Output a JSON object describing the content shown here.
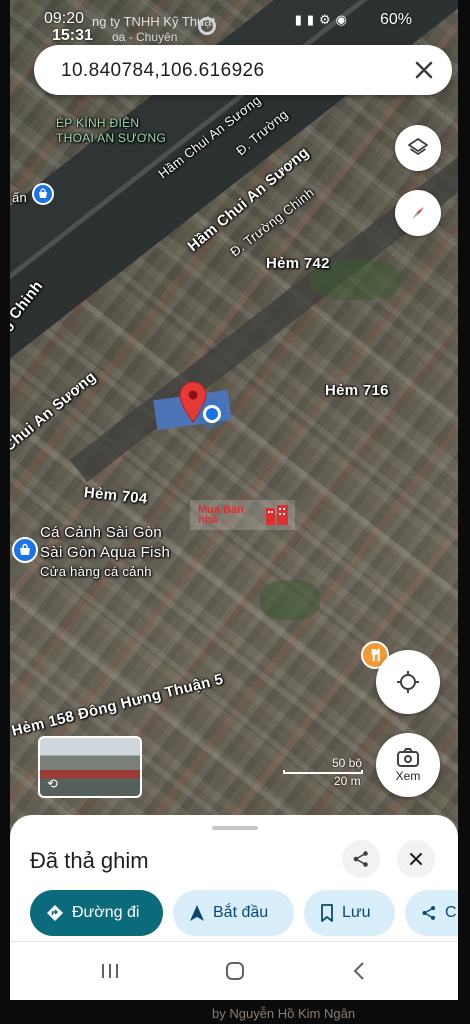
{
  "status": {
    "time": "09:20",
    "time_overlay": "15:31",
    "ghost_text": "ng ty TNHH Kỹ Thuật",
    "ghost_text2": "oa - Chuyên",
    "battery": "60%"
  },
  "search": {
    "query": "10.840784,106.616926"
  },
  "map": {
    "labels": {
      "ham_chui_1": "Hầm Chui An Sương",
      "ham_chui_2": "Hầm Chui An Sương",
      "ham_chui_3": "Chui An Sương",
      "truong_chinh_1": "Đ. Trường",
      "truong_chinh_2": "Đ. Trường Chinh",
      "truong_chinh_left": "g Chinh",
      "ep_kinh_1": "ÉP KÍNH ĐIỆN",
      "ep_kinh_2": "THOẠI AN SƯƠNG",
      "left_an": "ấn",
      "hem_742": "Hẻm 742",
      "hem_716": "Hẻm 716",
      "hem_704": "Hẻm 704",
      "poi_name_1": "Cá Cảnh Sài Gòn",
      "poi_name_2": "Sài Gòn Aqua Fish",
      "poi_sub": "Cửa hàng cá cảnh",
      "hem_158": "Hẻm 158 Đông Hưng Thuận 5"
    },
    "watermark": "Mua Bán nhà",
    "scale_ft": "50 bộ",
    "scale_m": "20 m",
    "streetview_label": "Xem"
  },
  "sheet": {
    "title": "Đã thả ghim",
    "chips": [
      {
        "label": "Đường đi"
      },
      {
        "label": "Bắt đầu"
      },
      {
        "label": "Lưu"
      },
      {
        "label": "C"
      }
    ]
  },
  "behind_text": "by Nguyễn Hồ Kim Ngân",
  "colors": {
    "primary_chip": "#0b6b7a",
    "secondary_chip": "#d8eefa",
    "pin_red": "#e53935",
    "location_blue": "#1a73e8"
  }
}
